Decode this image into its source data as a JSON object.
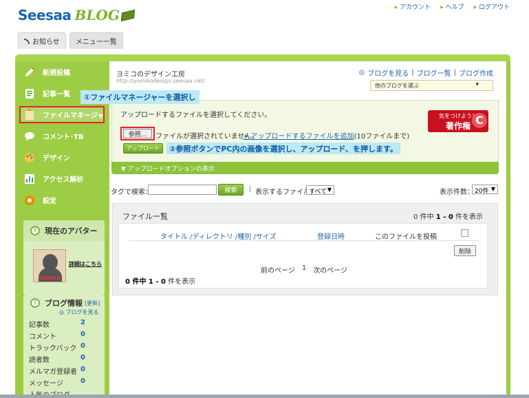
{
  "header": {
    "logo_main": "Seesaa",
    "logo_sub": "BLOG",
    "top_links": [
      "アカウント",
      "ヘルプ",
      "ログアウト"
    ]
  },
  "tabs": [
    "お知らせ",
    "メニュー一覧"
  ],
  "sidebar": {
    "items": [
      {
        "label": "新規投稿",
        "icon": "pencil-icon"
      },
      {
        "label": "記事一覧",
        "icon": "document-icon"
      },
      {
        "label": "ファイルマネージャ",
        "icon": "file-icon"
      },
      {
        "label": "コメント･TB",
        "icon": "comment-icon"
      },
      {
        "label": "デザイン",
        "icon": "palette-icon"
      },
      {
        "label": "アクセス解析",
        "icon": "bar-chart-icon"
      },
      {
        "label": "設定",
        "icon": "gear-icon"
      }
    ],
    "avatar": {
      "title": "現在のアバター",
      "sample": "SAMPLE",
      "link": "詳細はこちら"
    },
    "blog_info": {
      "title": "ブログ情報",
      "update": "[更新]",
      "view_blog": "ブログを見る",
      "stats": [
        {
          "label": "記事数",
          "value": "2"
        },
        {
          "label": "コメント",
          "value": "0"
        },
        {
          "label": "トラックバック",
          "value": "0"
        },
        {
          "label": "読者数",
          "value": "0"
        },
        {
          "label": "メルマガ登録者",
          "value": "0"
        },
        {
          "label": "メッセージ",
          "value": "0"
        },
        {
          "label": "人気のブログ",
          "value": ""
        }
      ]
    }
  },
  "blog": {
    "name": "ヨミコのデザイン工房",
    "url": "http://yomikodesign.seesaa.net/",
    "links": [
      "ブログを見る",
      "ブログ一覧",
      "ブログ作成"
    ],
    "select_placeholder": "他のブログを選ぶ"
  },
  "upload": {
    "message": "アップロードするファイルを選択してください。",
    "browse_label": "参照...",
    "no_file": "ファイルが選択されていません。",
    "add_link": "+ アップロードするファイルを追加",
    "add_count": "(10ファイルまで)",
    "upload_button": "アップロード",
    "options_label": "▼ アップロードオプションの表示",
    "banner_line1": "気をつけよう！",
    "banner_line2": "著作権",
    "banner_mark": "C"
  },
  "annotations": {
    "step1": "①ファイルマネージャーを選択し",
    "step2": "②参照ボタンでPC内の画像を選択し、アップロード、を押します。"
  },
  "search": {
    "label": "タグで検索：",
    "button": "検索",
    "filter_label": "表示するファイル",
    "filter_value": "すべて",
    "per_page_label": "表示件数：",
    "per_page_value": "20件"
  },
  "file_list": {
    "title": "ファイル一覧",
    "count_pre": "0 件中 ",
    "count_range": "1 - 0",
    "count_post": " 件を表示",
    "columns": {
      "title": "タイトル",
      "directory": "ディレクトリ",
      "type": "種別",
      "size": "サイズ",
      "date": "登録日時",
      "post": "このファイルを投稿"
    },
    "delete_button": "削除",
    "pager": {
      "prev": "前のページ",
      "page": "1",
      "next": "次のページ"
    }
  }
}
